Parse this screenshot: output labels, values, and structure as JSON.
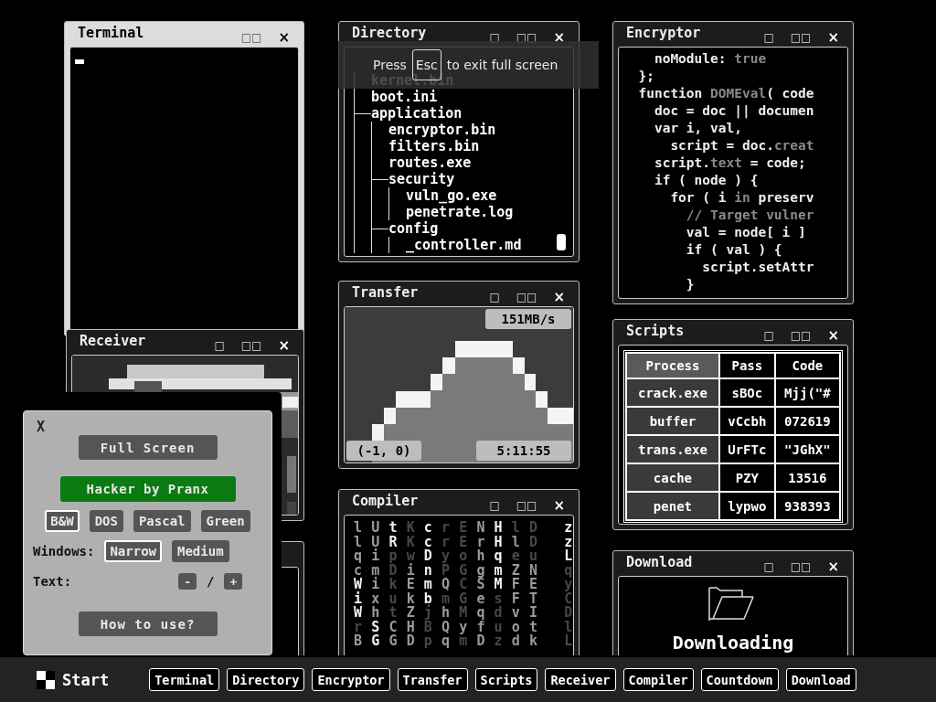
{
  "windows": [
    {
      "kind": "terminal",
      "title": "Terminal",
      "active": true,
      "controls": [
        "□□",
        "×"
      ]
    },
    {
      "kind": "directory",
      "title": "Directory",
      "active": false,
      "controls": [
        "□",
        "□□",
        "×"
      ],
      "tree": [
        {
          "name": "kernel.bin"
        },
        {
          "name": "boot.ini"
        },
        {
          "name": "application",
          "children": [
            {
              "name": "encryptor.bin"
            },
            {
              "name": "filters.bin"
            },
            {
              "name": "routes.exe"
            },
            {
              "name": "security",
              "children": [
                {
                  "name": "vuln_go.exe"
                },
                {
                  "name": "penetrate.log"
                }
              ]
            },
            {
              "name": "config",
              "children": [
                {
                  "name": "_controller.md"
                }
              ]
            }
          ]
        }
      ]
    },
    {
      "kind": "code",
      "title": "Encryptor",
      "active": false,
      "controls": [
        "□",
        "□□",
        "×"
      ],
      "lines": [
        {
          "segments": [
            {
              "text": "    noModule: ",
              "dim": false
            },
            {
              "text": "true",
              "dim": true
            }
          ]
        },
        {
          "segments": [
            {
              "text": "  };",
              "dim": false
            }
          ]
        },
        {
          "segments": [
            {
              "text": "  function ",
              "dim": false
            },
            {
              "text": "DOMEval",
              "dim": true
            },
            {
              "text": "( code",
              "dim": false
            }
          ]
        },
        {
          "segments": [
            {
              "text": "    doc = doc || documen",
              "dim": false
            }
          ]
        },
        {
          "segments": [
            {
              "text": "    var i, val,",
              "dim": false
            }
          ]
        },
        {
          "segments": [
            {
              "text": "      script = doc.",
              "dim": false
            },
            {
              "text": "creat",
              "dim": true
            }
          ]
        },
        {
          "segments": [
            {
              "text": "    script.",
              "dim": false
            },
            {
              "text": "text",
              "dim": true
            },
            {
              "text": " = code;",
              "dim": false
            }
          ]
        },
        {
          "segments": [
            {
              "text": "    if ( node ) {",
              "dim": false
            }
          ]
        },
        {
          "segments": [
            {
              "text": "      for ( i ",
              "dim": false
            },
            {
              "text": "in",
              "dim": true
            },
            {
              "text": " preserv",
              "dim": false
            }
          ]
        },
        {
          "segments": [
            {
              "text": "        // Target vulner",
              "dim": true
            }
          ]
        },
        {
          "segments": [
            {
              "text": "        val = node[ i ]",
              "dim": false
            }
          ]
        },
        {
          "segments": [
            {
              "text": "        if ( val ) {",
              "dim": false
            }
          ]
        },
        {
          "segments": [
            {
              "text": "          script.setAttr",
              "dim": false
            }
          ]
        },
        {
          "segments": [
            {
              "text": "        }",
              "dim": false
            }
          ]
        }
      ]
    },
    {
      "kind": "receiver",
      "title": "Receiver",
      "active": false,
      "controls": [
        "□",
        "□□",
        "×"
      ]
    },
    {
      "kind": "transfer",
      "title": "Transfer",
      "active": false,
      "controls": [
        "□",
        "□□",
        "×"
      ],
      "speed": "151MB/s",
      "coords": "(-1, 0)",
      "time": "5:11:55"
    },
    {
      "kind": "table",
      "title": "Scripts",
      "active": false,
      "controls": [
        "□",
        "□□",
        "×"
      ],
      "columns": [
        {
          "label": "Process",
          "sorted": true
        },
        {
          "label": "Pass",
          "sorted": false
        },
        {
          "label": "Code",
          "sorted": false
        }
      ],
      "rows": [
        [
          "crack.exe",
          "sBOc",
          "Mjj(\"#"
        ],
        [
          "buffer",
          "vCcbh",
          "072619"
        ],
        [
          "trans.exe",
          "UrFTc",
          "\"JGhX\""
        ],
        [
          "cache",
          "PZY",
          "13516"
        ],
        [
          "penet",
          "lypwo",
          "938393"
        ]
      ]
    },
    {
      "kind": "matrix",
      "title": "Compiler",
      "active": false,
      "controls": [
        "□",
        "□□",
        "×"
      ],
      "rows": [
        [
          {
            "text": "l",
            "color": "#9a9a9a"
          },
          {
            "text": "U",
            "color": "#9a9a9a"
          },
          {
            "text": "t",
            "color": "#f2f2f2"
          },
          {
            "text": "K",
            "color": "#474747"
          },
          {
            "text": "c",
            "color": "#f2f2f2"
          },
          {
            "text": "r",
            "color": "#474747"
          },
          {
            "text": "E",
            "color": "#474747"
          },
          {
            "text": "N",
            "color": "#9a9a9a"
          },
          {
            "text": "H",
            "color": "#f2f2f2"
          },
          {
            "text": "l",
            "color": "#474747"
          },
          {
            "text": "D",
            "color": "#474747"
          },
          {
            "text": "z",
            "color": "#f2f2f2"
          }
        ],
        [
          {
            "text": "l",
            "color": "#9a9a9a"
          },
          {
            "text": "U",
            "color": "#9a9a9a"
          },
          {
            "text": "R",
            "color": "#f2f2f2"
          },
          {
            "text": "K",
            "color": "#474747"
          },
          {
            "text": "c",
            "color": "#f2f2f2"
          },
          {
            "text": "r",
            "color": "#474747"
          },
          {
            "text": "E",
            "color": "#474747"
          },
          {
            "text": "r",
            "color": "#9a9a9a"
          },
          {
            "text": "H",
            "color": "#f2f2f2"
          },
          {
            "text": "l",
            "color": "#9a9a9a"
          },
          {
            "text": "D",
            "color": "#474747"
          },
          {
            "text": "z",
            "color": "#f2f2f2"
          }
        ],
        [
          {
            "text": "q",
            "color": "#9a9a9a"
          },
          {
            "text": "i",
            "color": "#9a9a9a"
          },
          {
            "text": "p",
            "color": "#474747"
          },
          {
            "text": "w",
            "color": "#474747"
          },
          {
            "text": "D",
            "color": "#f2f2f2"
          },
          {
            "text": "y",
            "color": "#474747"
          },
          {
            "text": "o",
            "color": "#474747"
          },
          {
            "text": "h",
            "color": "#9a9a9a"
          },
          {
            "text": "q",
            "color": "#f2f2f2"
          },
          {
            "text": "e",
            "color": "#474747"
          },
          {
            "text": "u",
            "color": "#474747"
          },
          {
            "text": "L",
            "color": "#f2f2f2"
          }
        ],
        [
          {
            "text": "c",
            "color": "#9a9a9a"
          },
          {
            "text": "m",
            "color": "#9a9a9a"
          },
          {
            "text": "D",
            "color": "#474747"
          },
          {
            "text": "i",
            "color": "#9a9a9a"
          },
          {
            "text": "n",
            "color": "#f2f2f2"
          },
          {
            "text": "P",
            "color": "#474747"
          },
          {
            "text": "G",
            "color": "#474747"
          },
          {
            "text": "g",
            "color": "#9a9a9a"
          },
          {
            "text": "m",
            "color": "#f2f2f2"
          },
          {
            "text": "Z",
            "color": "#9a9a9a"
          },
          {
            "text": "N",
            "color": "#9a9a9a"
          },
          {
            "text": "q",
            "color": "#474747"
          }
        ],
        [
          {
            "text": "W",
            "color": "#f2f2f2"
          },
          {
            "text": "i",
            "color": "#9a9a9a"
          },
          {
            "text": "k",
            "color": "#474747"
          },
          {
            "text": "E",
            "color": "#9a9a9a"
          },
          {
            "text": "m",
            "color": "#f2f2f2"
          },
          {
            "text": "Q",
            "color": "#9a9a9a"
          },
          {
            "text": "C",
            "color": "#474747"
          },
          {
            "text": "S",
            "color": "#9a9a9a"
          },
          {
            "text": "M",
            "color": "#f2f2f2"
          },
          {
            "text": "F",
            "color": "#9a9a9a"
          },
          {
            "text": "E",
            "color": "#9a9a9a"
          },
          {
            "text": "y",
            "color": "#474747"
          }
        ],
        [
          {
            "text": "i",
            "color": "#f2f2f2"
          },
          {
            "text": "x",
            "color": "#9a9a9a"
          },
          {
            "text": "u",
            "color": "#474747"
          },
          {
            "text": "k",
            "color": "#9a9a9a"
          },
          {
            "text": "b",
            "color": "#f2f2f2"
          },
          {
            "text": "m",
            "color": "#474747"
          },
          {
            "text": "G",
            "color": "#474747"
          },
          {
            "text": "e",
            "color": "#9a9a9a"
          },
          {
            "text": "s",
            "color": "#474747"
          },
          {
            "text": "F",
            "color": "#9a9a9a"
          },
          {
            "text": "T",
            "color": "#9a9a9a"
          },
          {
            "text": "C",
            "color": "#474747"
          }
        ],
        [
          {
            "text": "W",
            "color": "#f2f2f2"
          },
          {
            "text": "h",
            "color": "#9a9a9a"
          },
          {
            "text": "t",
            "color": "#474747"
          },
          {
            "text": "Z",
            "color": "#9a9a9a"
          },
          {
            "text": "j",
            "color": "#474747"
          },
          {
            "text": "h",
            "color": "#9a9a9a"
          },
          {
            "text": "M",
            "color": "#474747"
          },
          {
            "text": "q",
            "color": "#9a9a9a"
          },
          {
            "text": "d",
            "color": "#474747"
          },
          {
            "text": "v",
            "color": "#9a9a9a"
          },
          {
            "text": "I",
            "color": "#9a9a9a"
          },
          {
            "text": "D",
            "color": "#474747"
          }
        ],
        [
          {
            "text": "r",
            "color": "#474747"
          },
          {
            "text": "S",
            "color": "#f2f2f2"
          },
          {
            "text": "C",
            "color": "#9a9a9a"
          },
          {
            "text": "H",
            "color": "#9a9a9a"
          },
          {
            "text": "B",
            "color": "#474747"
          },
          {
            "text": "Q",
            "color": "#9a9a9a"
          },
          {
            "text": "y",
            "color": "#9a9a9a"
          },
          {
            "text": "f",
            "color": "#9a9a9a"
          },
          {
            "text": "u",
            "color": "#474747"
          },
          {
            "text": "o",
            "color": "#9a9a9a"
          },
          {
            "text": "t",
            "color": "#9a9a9a"
          },
          {
            "text": "l",
            "color": "#474747"
          }
        ],
        [
          {
            "text": "B",
            "color": "#9a9a9a"
          },
          {
            "text": "G",
            "color": "#f2f2f2"
          },
          {
            "text": "G",
            "color": "#9a9a9a"
          },
          {
            "text": "D",
            "color": "#9a9a9a"
          },
          {
            "text": "p",
            "color": "#474747"
          },
          {
            "text": "q",
            "color": "#9a9a9a"
          },
          {
            "text": "m",
            "color": "#474747"
          },
          {
            "text": "D",
            "color": "#9a9a9a"
          },
          {
            "text": "z",
            "color": "#474747"
          },
          {
            "text": "d",
            "color": "#9a9a9a"
          },
          {
            "text": "k",
            "color": "#9a9a9a"
          },
          {
            "text": "L",
            "color": "#474747"
          }
        ]
      ]
    },
    {
      "kind": "download",
      "title": "Download",
      "active": false,
      "controls": [
        "□",
        "□□",
        "×"
      ],
      "status": "Downloading"
    }
  ],
  "fullscreen_notice": {
    "before": "Press",
    "key": "Esc",
    "after": "to exit full screen"
  },
  "panel": {
    "close": "X",
    "fullscreen": "Full Screen",
    "brand": "Hacker by Pranx",
    "themes": [
      {
        "label": "B&W",
        "selected": true
      },
      {
        "label": "DOS",
        "selected": false
      },
      {
        "label": "Pascal",
        "selected": false
      },
      {
        "label": "Green",
        "selected": false
      }
    ],
    "windows_label": "Windows:",
    "sizes": [
      {
        "label": "Narrow",
        "selected": true
      },
      {
        "label": "Medium",
        "selected": false
      }
    ],
    "text_label": "Text:",
    "decrease": "-",
    "separator": "/",
    "increase": "+",
    "help": "How to use?"
  },
  "taskbar": {
    "start": "Start",
    "buttons": [
      "Terminal",
      "Directory",
      "Encryptor",
      "Transfer",
      "Scripts",
      "Receiver",
      "Compiler",
      "Countdown",
      "Download"
    ]
  }
}
